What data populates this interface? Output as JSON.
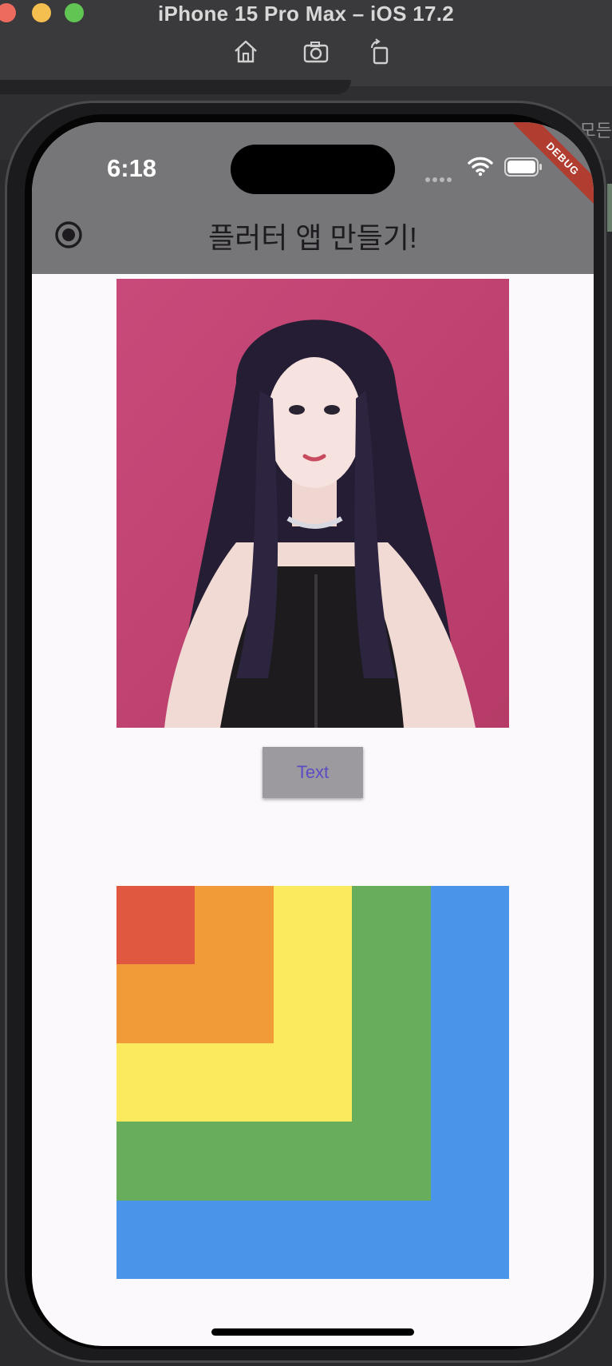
{
  "window": {
    "title": "iPhone 15 Pro Max – iOS 17.2",
    "toolbar": [
      "home-icon",
      "screenshot-icon",
      "rotate-icon"
    ],
    "behind_text": "모든"
  },
  "status_bar": {
    "time": "6:18"
  },
  "debug_banner": "DEBUG",
  "app_bar": {
    "title": "플러터 앱 만들기!",
    "leading_icon": "radio-button-icon"
  },
  "content": {
    "button_label": "Text",
    "photo_description_icon": "photo-image",
    "color_boxes": [
      {
        "name": "blue-box",
        "color": "#4a95ea"
      },
      {
        "name": "green-box",
        "color": "#67ad5b"
      },
      {
        "name": "yellow-box",
        "color": "#fbea5e"
      },
      {
        "name": "orange-box",
        "color": "#f19b38"
      },
      {
        "name": "red-box",
        "color": "#e15841"
      }
    ]
  },
  "colors": {
    "app_bar": "#767577",
    "background": "#fcf9fd",
    "button_text": "#5b4cc4"
  }
}
